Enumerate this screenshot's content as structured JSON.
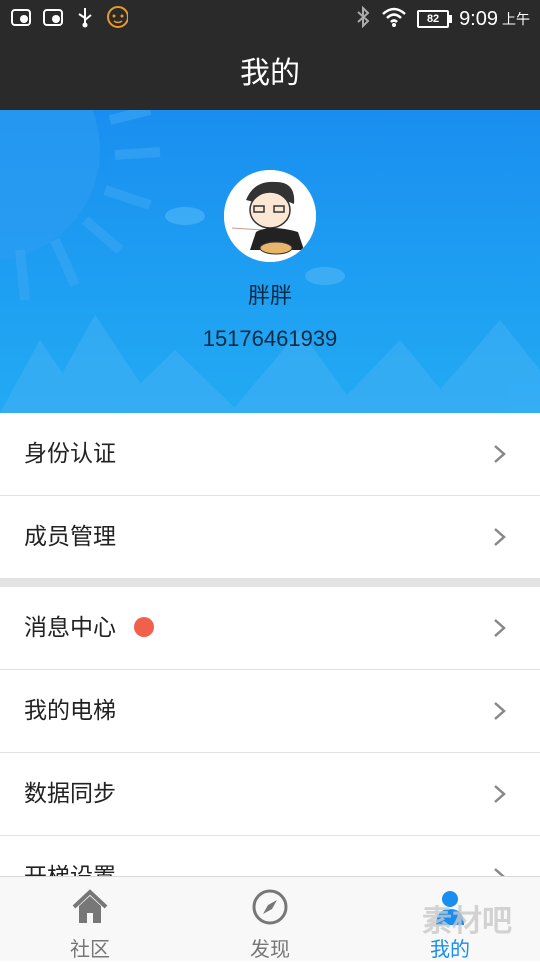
{
  "status_bar": {
    "time": "9:09",
    "ampm": "上午",
    "battery": "82"
  },
  "header": {
    "title": "我的"
  },
  "profile": {
    "name": "胖胖",
    "phone": "15176461939"
  },
  "menu": {
    "group1": [
      {
        "label": "身份认证"
      },
      {
        "label": "成员管理"
      }
    ],
    "group2": [
      {
        "label": "消息中心",
        "badge": true
      },
      {
        "label": "我的电梯"
      },
      {
        "label": "数据同步"
      },
      {
        "label": "开梯设置"
      }
    ]
  },
  "tabs": [
    {
      "label": "社区",
      "icon": "home-icon"
    },
    {
      "label": "发现",
      "icon": "compass-icon"
    },
    {
      "label": "我的",
      "icon": "person-icon",
      "active": true
    }
  ],
  "watermark": "素材吧",
  "colors": {
    "accent": "#1a8ef0",
    "dark_bar": "#2a2a2a",
    "badge": "#f0604a"
  }
}
